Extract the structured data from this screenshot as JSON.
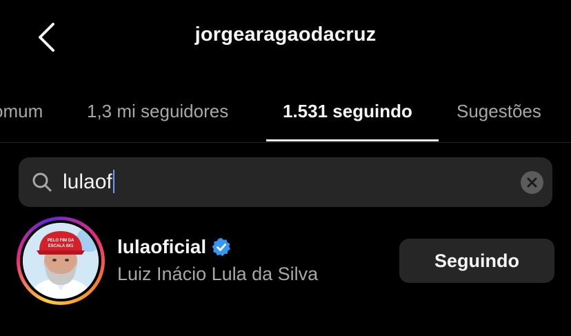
{
  "header": {
    "title": "jorgearagaodacruz",
    "back_icon": "chevron-left-icon"
  },
  "tabs": [
    {
      "label": "omum",
      "active": false
    },
    {
      "label": "1,3 mi seguidores",
      "active": false
    },
    {
      "label": "1.531 seguindo",
      "active": true
    },
    {
      "label": "Sugestões",
      "active": false
    }
  ],
  "search": {
    "value": "lulaof",
    "icon": "search-icon",
    "clear_icon": "close-icon"
  },
  "results": [
    {
      "username": "lulaoficial",
      "verified": true,
      "full_name": "Luiz Inácio Lula da Silva",
      "button_label": "Seguindo",
      "avatar_cap_text": "PELO FIM DA ESCALA 6X1"
    }
  ],
  "colors": {
    "background": "#000000",
    "text_primary": "#f5f5f5",
    "text_secondary": "#a8a8a8",
    "surface": "#262626",
    "verified_blue": "#3797f0"
  }
}
